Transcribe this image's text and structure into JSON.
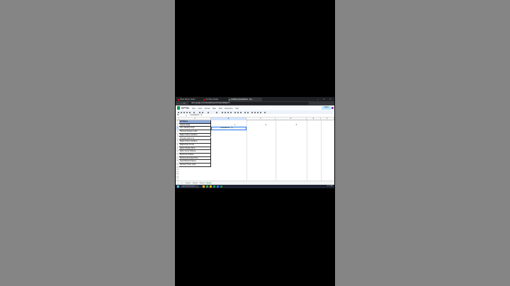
{
  "browser": {
    "tabs": [
      "Short Morse Video",
      "YouTube Studio",
      "Untitled spreadsheet - Go..."
    ],
    "url": "docs.google.com/spreadsheets/d/1xj1/edit#gid=0",
    "nav_icons": [
      "back-icon",
      "forward-icon",
      "reload-icon"
    ]
  },
  "sheets": {
    "doc_title": "Untitled",
    "menus": [
      "File",
      "Edit",
      "View",
      "Insert",
      "Format",
      "Data",
      "Tools",
      "Extensions",
      "Help"
    ],
    "share_label": "Share",
    "name_box": "B3",
    "formula": "=len(split(A3,\" \"))"
  },
  "grid": {
    "columns": [
      "A",
      "B",
      "C",
      "D",
      "E",
      "F"
    ],
    "row_numbers": [
      "1",
      "2",
      "3",
      "4",
      "5",
      "6",
      "7",
      "8",
      "9",
      "10",
      "11",
      "12",
      "13",
      "14",
      "15",
      "16",
      "17",
      "18"
    ],
    "header": "All Names",
    "names": [
      "Anjana Singla",
      "Ashu Maharaj Singh",
      "Harmeet Narayan Lodhi",
      "Rajan Krishna Gandhari",
      "Priyanka sharma ok",
      "Rajan Krishna Gandhari",
      "Radha Rani Kumari",
      "Rahul Chhabra Minor",
      "Ramu Kumar Sharma",
      "Raj Kumari Kataria",
      "Mohammad Ghaad Khan",
      "Ankur Bhanot Khanna",
      "Ashwani Kumar singh"
    ],
    "values_row2": [
      "1",
      "2",
      "3"
    ]
  },
  "sheet_tabs": [
    "+",
    "≡",
    "Sheet1",
    "Sheet2",
    "Sheet3",
    "Sheet4"
  ],
  "taskbar": {
    "search_placeholder": "Type here to search",
    "clock": "10:47 AM"
  },
  "colors": {
    "header_fill": "#8eaadb",
    "selection": "#1a73e8",
    "sheets_green": "#0f9d58"
  }
}
